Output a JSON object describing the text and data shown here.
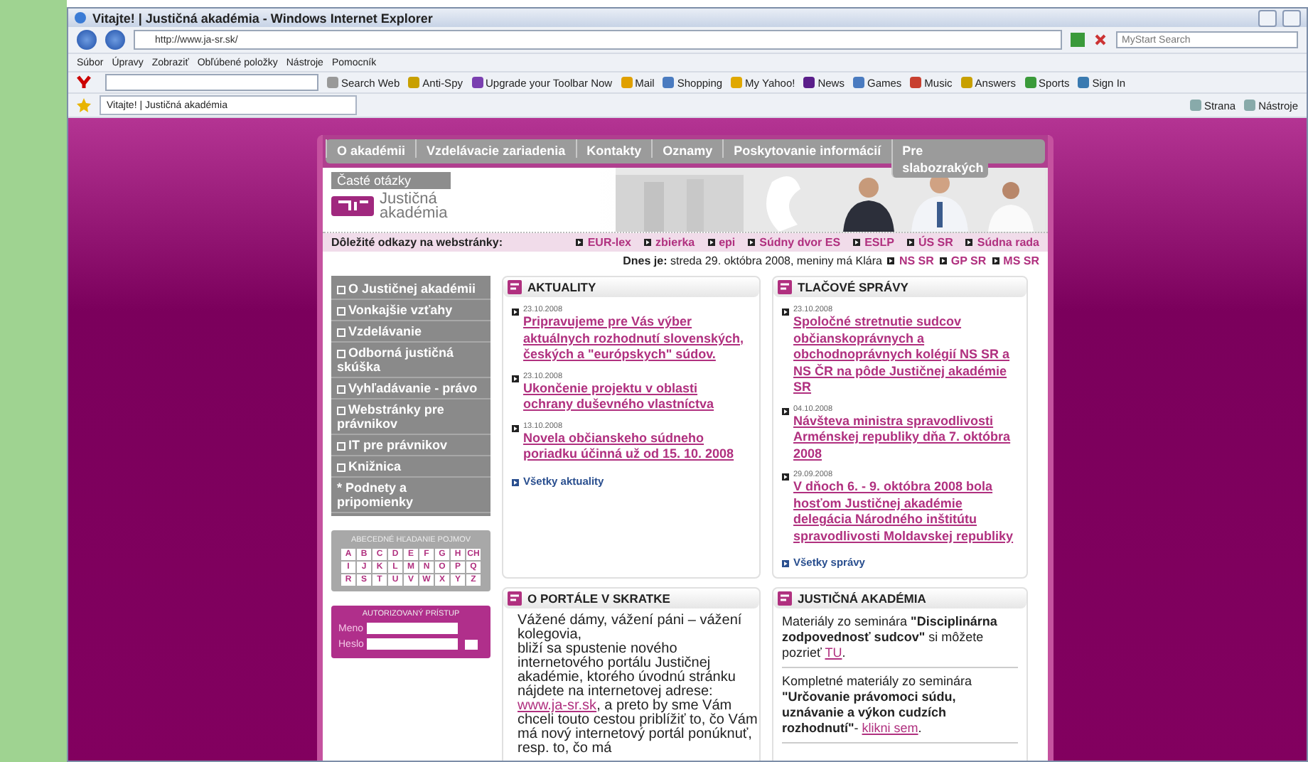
{
  "browser": {
    "title": "Vitajte! | Justičná akadémia - Windows Internet Explorer",
    "address": "http://www.ja-sr.sk/",
    "search_placeholder": "MyStart Search",
    "menu": [
      "Súbor",
      "Úpravy",
      "Zobraziť",
      "Obľúbené položky",
      "Nástroje",
      "Pomocník"
    ],
    "toolbar": [
      "Search Web",
      "Anti-Spy",
      "Upgrade your Toolbar Now",
      "Mail",
      "Shopping",
      "My Yahoo!",
      "News",
      "Games",
      "Music",
      "Answers",
      "Sports",
      "Sign In"
    ],
    "tab": "Vitajte! | Justičná akadémia",
    "commands": [
      "Strana",
      "Nástroje"
    ]
  },
  "site": {
    "nav": [
      "O akadémii",
      "Vzdelávacie zariadenia",
      "Kontakty",
      "Oznamy",
      "Poskytovanie informácií",
      "Pre slabozrakých"
    ],
    "faq_tab": "Časté otázky",
    "logo": [
      "Justičná",
      "akadémia"
    ],
    "important_links": {
      "label": "Dôležité odkazy na webstránky:",
      "links": [
        "EUR-lex",
        "zbierka",
        "epi",
        "Súdny dvor ES",
        "ESĽP",
        "ÚS SR",
        "Súdna rada"
      ]
    },
    "date_line": {
      "text": "**Dnes je:** streda 29. októbra 2008, meniny má Klára",
      "links": [
        "NS SR",
        "GP SR",
        "MS SR"
      ]
    },
    "side_menu": [
      {
        "label": "O Justičnej akadémii",
        "kind": "bullet"
      },
      {
        "label": "Vonkajšie vzťahy",
        "kind": "bullet"
      },
      {
        "label": "Vzdelávanie",
        "kind": "bullet"
      },
      {
        "label": "Odborná justičná skúška",
        "kind": "bullet"
      },
      {
        "label": "Vyhľadávanie - právo",
        "kind": "bullet"
      },
      {
        "label": "Webstránky pre právnikov",
        "kind": "bullet"
      },
      {
        "label": "IT pre právnikov",
        "kind": "bullet"
      },
      {
        "label": "Knižnica",
        "kind": "bullet"
      },
      {
        "label": "* Podnety a pripomienky",
        "kind": "plain"
      }
    ],
    "alphabet": {
      "title": "ABECEDNÉ HĽADANIE POJMOV",
      "letters": [
        "A",
        "B",
        "C",
        "D",
        "E",
        "F",
        "G",
        "H",
        "CH",
        "I",
        "J",
        "K",
        "L",
        "M",
        "N",
        "O",
        "P",
        "Q",
        "R",
        "S",
        "T",
        "U",
        "V",
        "W",
        "X",
        "Y",
        "Z"
      ]
    },
    "login": {
      "title": "AUTORIZOVANÝ PRÍSTUP",
      "fields": [
        {
          "label": "Meno",
          "kind": "text"
        },
        {
          "label": "Heslo",
          "kind": "password"
        }
      ]
    },
    "news": {
      "title": "AKTUALITY",
      "items": [
        {
          "date": "23.10.2008",
          "title": "Pripravujeme pre Vás výber aktuálnych rozhodnutí slovenských, českých a \"európskych\" súdov."
        },
        {
          "date": "23.10.2008",
          "title": "Ukončenie projektu v oblasti ochrany duševného vlastníctva"
        },
        {
          "date": "13.10.2008",
          "title": "Novela občianskeho súdneho poriadku účinná už od 15. 10. 2008"
        }
      ],
      "more": "Všetky aktuality"
    },
    "press": {
      "title": "TLAČOVÉ SPRÁVY",
      "items": [
        {
          "date": "23.10.2008",
          "title": "Spoločné stretnutie sudcov občianskoprávnych a obchodnoprávnych kolégií NS SR a NS ČR na pôde Justičnej akadémie SR"
        },
        {
          "date": "04.10.2008",
          "title": "Návšteva ministra spravodlivosti Arménskej republiky dňa 7. októbra 2008"
        },
        {
          "date": "29.09.2008",
          "title": "V dňoch 6. - 9. októbra 2008 bola hosťom Justičnej akadémie delegácia Národného inštitútu spravodlivosti Moldavskej republiky"
        }
      ],
      "more": "Všetky správy"
    },
    "about": {
      "title": "O PORTÁLE V SKRATKE",
      "text": "Vážené dámy, vážení páni – vážení kolegovia,\nbliží sa spustenie nového internetového portálu Justičnej akadémie, ktorého úvodnú stránku nájdete na internetovej adrese: ",
      "link": "www.ja-sr.sk",
      "tail": ", a preto by sme Vám chceli touto cestou priblížiť to, čo Vám má nový internetový portál ponúknuť, resp. to, čo má"
    },
    "academy": {
      "title": "JUSTIČNÁ AKADÉMIA",
      "items": [
        {
          "text": "Materiály zo seminára **\"Disciplinárna zodpovednosť sudcov\"** si môžete pozrieť ",
          "link": "TU",
          "tail": "."
        },
        {
          "text": "Kompletné materiály zo seminára **\"Určovanie právomoci súdu, uznávanie a výkon cudzích rozhodnutí\"**- ",
          "link": "klikni sem",
          "tail": "."
        }
      ]
    }
  }
}
